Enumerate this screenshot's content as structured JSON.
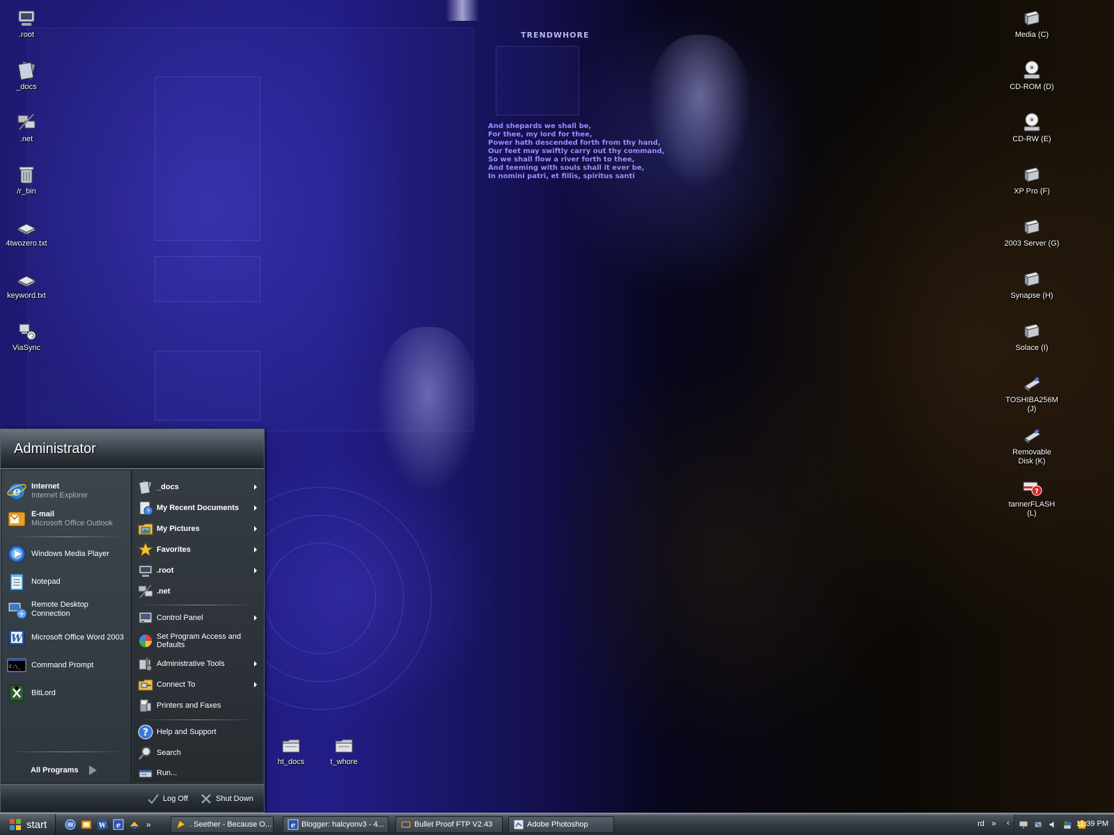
{
  "wallpaper": {
    "brand": "TRENDWHORE",
    "poem": [
      "And shepards we shall be,",
      "For thee, my lord for thee,",
      "Power hath descended forth from thy hand,",
      "Our feet may swiftly carry out thy command,",
      "So we shall flow a river forth to thee,",
      "And teeming with souls shall it ever be,",
      "In nomini patri, et fillis, spiritus santi"
    ]
  },
  "desktop": {
    "left_icons": [
      {
        "label": ".root",
        "icon": "computer-icon"
      },
      {
        "label": "_docs",
        "icon": "documents-icon"
      },
      {
        "label": ".net",
        "icon": "network-icon"
      },
      {
        "label": "/r_bin",
        "icon": "recycle-bin-icon"
      },
      {
        "label": "4twozero.txt",
        "icon": "text-file-icon"
      },
      {
        "label": "keyword.txt",
        "icon": "text-file-icon"
      },
      {
        "label": "ViaSync",
        "icon": "sync-icon"
      }
    ],
    "right_icons": [
      {
        "label": "Media (C)",
        "icon": "hard-drive-icon"
      },
      {
        "label": "CD-ROM (D)",
        "icon": "cd-drive-icon"
      },
      {
        "label": "CD-RW (E)",
        "icon": "cd-drive-icon"
      },
      {
        "label": "XP Pro (F)",
        "icon": "hard-drive-icon"
      },
      {
        "label": "2003 Server (G)",
        "icon": "hard-drive-icon"
      },
      {
        "label": "Synapse (H)",
        "icon": "hard-drive-icon"
      },
      {
        "label": "Solace (I)",
        "icon": "hard-drive-icon"
      },
      {
        "label": "TOSHIBA256M (J)",
        "icon": "usb-drive-icon"
      },
      {
        "label": "Removable Disk (K)",
        "icon": "usb-drive-icon"
      },
      {
        "label": "tannerFLASH (L)",
        "icon": "unknown-drive-icon"
      }
    ],
    "bottom_icons": [
      {
        "label": "ht_docs",
        "icon": "folder-icon"
      },
      {
        "label": "t_whore",
        "icon": "folder-icon"
      }
    ]
  },
  "start_menu": {
    "username": "Administrator",
    "pinned": [
      {
        "title": "Internet",
        "subtitle": "Internet Explorer",
        "icon": "internet-explorer-icon"
      },
      {
        "title": "E-mail",
        "subtitle": "Microsoft Office Outlook",
        "icon": "outlook-icon"
      }
    ],
    "recent": [
      {
        "title": "Windows Media Player",
        "icon": "media-player-icon"
      },
      {
        "title": "Notepad",
        "icon": "notepad-icon"
      },
      {
        "title": "Remote Desktop Connection",
        "icon": "remote-desktop-icon"
      },
      {
        "title": "Microsoft Office Word 2003",
        "icon": "word-icon"
      },
      {
        "title": "Command Prompt",
        "icon": "command-prompt-icon"
      },
      {
        "title": "BitLord",
        "icon": "bitlord-icon"
      }
    ],
    "all_programs": "All Programs",
    "places": [
      {
        "title": "_docs",
        "icon": "documents-icon"
      },
      {
        "title": "My Recent Documents",
        "icon": "recent-documents-icon"
      },
      {
        "title": "My Pictures",
        "icon": "pictures-icon"
      },
      {
        "title": "Favorites",
        "icon": "star-icon"
      },
      {
        "title": ".root",
        "icon": "computer-icon"
      },
      {
        "title": ".net",
        "icon": "network-icon"
      }
    ],
    "system": [
      {
        "title": "Control Panel",
        "icon": "control-panel-icon"
      },
      {
        "title": "Set Program Access and Defaults",
        "icon": "program-access-icon"
      },
      {
        "title": "Administrative Tools",
        "icon": "admin-tools-icon"
      },
      {
        "title": "Connect To",
        "icon": "connect-icon"
      },
      {
        "title": "Printers and Faxes",
        "icon": "printer-icon"
      }
    ],
    "help": [
      {
        "title": "Help and Support",
        "icon": "help-icon"
      },
      {
        "title": "Search",
        "icon": "search-icon"
      },
      {
        "title": "Run...",
        "icon": "run-icon"
      }
    ],
    "log_off": "Log Off",
    "shut_down": "Shut Down"
  },
  "taskbar": {
    "start": "start",
    "quick_launch": [
      "desktop-icon",
      "outlook-icon",
      "word-icon",
      "internet-explorer-icon",
      "bitlord-icon"
    ],
    "tasks": [
      {
        "title": ". Seether - Because O...",
        "icon": "media-player-icon"
      },
      {
        "title": "Blogger: halcyonv3 - 4...",
        "icon": "internet-explorer-icon"
      },
      {
        "title": "Bullet Proof FTP V2.43",
        "icon": "ftp-icon"
      },
      {
        "title": "Adobe Photoshop",
        "icon": "photoshop-icon"
      }
    ],
    "address": "rd",
    "chevron": "»",
    "clock": "11:39 PM"
  }
}
